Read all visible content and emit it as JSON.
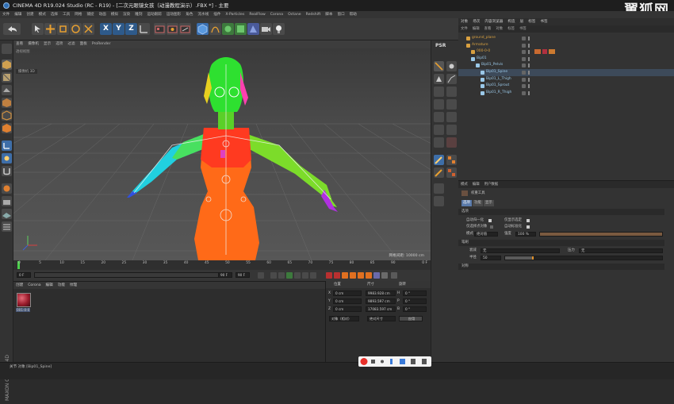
{
  "window": {
    "title": "CINEMA 4D R19.024 Studio (RC - R19) - [二次元眼镜女孩（动漫教程演示）.FBX *] - 主要",
    "watermark": "翼狐网"
  },
  "menubar": [
    "文件",
    "编辑",
    "创建",
    "模式",
    "选择",
    "工具",
    "网格",
    "捕捉",
    "动画",
    "模拟",
    "渲染",
    "雕刻",
    "运动跟踪",
    "运动图形",
    "角色",
    "流水线",
    "插件",
    "X-Particles",
    "RealFlow",
    "Corona",
    "Octane",
    "Redshift",
    "脚本",
    "窗口",
    "帮助"
  ],
  "viewport": {
    "menu": [
      "查看",
      "摄像机",
      "显示",
      "选项",
      "过滤",
      "面板",
      "ProRender"
    ],
    "label": "透视视图",
    "camera_label": "摄像机 3D",
    "grid_scale": "网格间距: 10000 cm"
  },
  "psr_label": "PSR",
  "timeline": {
    "ticks": [
      "0",
      "5",
      "10",
      "15",
      "20",
      "25",
      "30",
      "35",
      "40",
      "45",
      "50",
      "55",
      "60",
      "65",
      "70",
      "75",
      "80",
      "85",
      "90"
    ],
    "end_label": "0 F",
    "start_field": "0 F",
    "current_field": "0 F",
    "end_field": "90 F",
    "end_field2": "90 F"
  },
  "material_panel": {
    "tabs": [
      "创建",
      "Corona",
      "编辑",
      "功能",
      "纹理"
    ],
    "material_name": "001-0-0"
  },
  "coord_panel": {
    "headers": [
      "位置",
      "尺寸",
      "旋转"
    ],
    "rows": [
      {
        "axis": "X",
        "pos": "0 cm",
        "size": "9983.928 cm",
        "rot_label": "H",
        "rot": "0 °"
      },
      {
        "axis": "Y",
        "pos": "0 cm",
        "size": "9893.597 cm",
        "rot_label": "P",
        "rot": "0 °"
      },
      {
        "axis": "Z",
        "pos": "0 cm",
        "size": "17083.597 cm",
        "rot_label": "B",
        "rot": "0 °"
      }
    ],
    "mode_select": "对象（相对）",
    "size_select": "绝对尺寸",
    "apply": "应用"
  },
  "object_panel": {
    "tabs": [
      "对象",
      "场次",
      "内容浏览器",
      "构造",
      "层",
      "标签",
      "书签"
    ],
    "menu": [
      "文件",
      "编辑",
      "查看",
      "对象",
      "标签",
      "书签"
    ],
    "items": [
      {
        "name": "ground_plane",
        "indent": 1,
        "color": "#d8a040"
      },
      {
        "name": "Armature",
        "indent": 1,
        "color": "#d8a040"
      },
      {
        "name": "000-0-0",
        "indent": 2,
        "color": "#d8a040"
      },
      {
        "name": "Bip01",
        "indent": 2,
        "color": "#9ac8e8"
      },
      {
        "name": "Bip01_Pelvis",
        "indent": 3,
        "color": "#9ac8e8"
      },
      {
        "name": "Bip01_Spine",
        "indent": 4,
        "color": "#9ac8e8"
      },
      {
        "name": "Bip01_L_Thigh",
        "indent": 4,
        "color": "#9ac8e8"
      },
      {
        "name": "Bip01_Sprout",
        "indent": 4,
        "color": "#9ac8e8"
      },
      {
        "name": "Bip01_R_Thigh",
        "indent": 4,
        "color": "#9ac8e8"
      }
    ]
  },
  "attr_panel": {
    "menu": [
      "模式",
      "编辑",
      "用户数据"
    ],
    "tool_name": "权重工具",
    "tabs": [
      "选项",
      "功能",
      "显示"
    ],
    "section_options": "选项",
    "rows": {
      "auto_norm": "自动归一化",
      "show_toggle": "仅显示选定",
      "selected_only": "仅选择点对象",
      "auto_weight": "自动标准化",
      "mode_label": "模式",
      "mode_value": "绝对值",
      "strength_label": "强度",
      "strength_value": "100 %",
      "section_brush": "笔刷",
      "falloff_label": "衰减",
      "falloff_value": "无",
      "pressure_label": "压力",
      "pressure_value": "无",
      "radius_label": "半径",
      "radius_value": "50",
      "section_symmetry": "对称"
    },
    "strength_fill": 1.0,
    "radius_fill": 0.18
  },
  "status": {
    "text": "关节 对象 [Bip01_Spine]"
  },
  "maxon_label": "MAXON CINEMA 4D"
}
